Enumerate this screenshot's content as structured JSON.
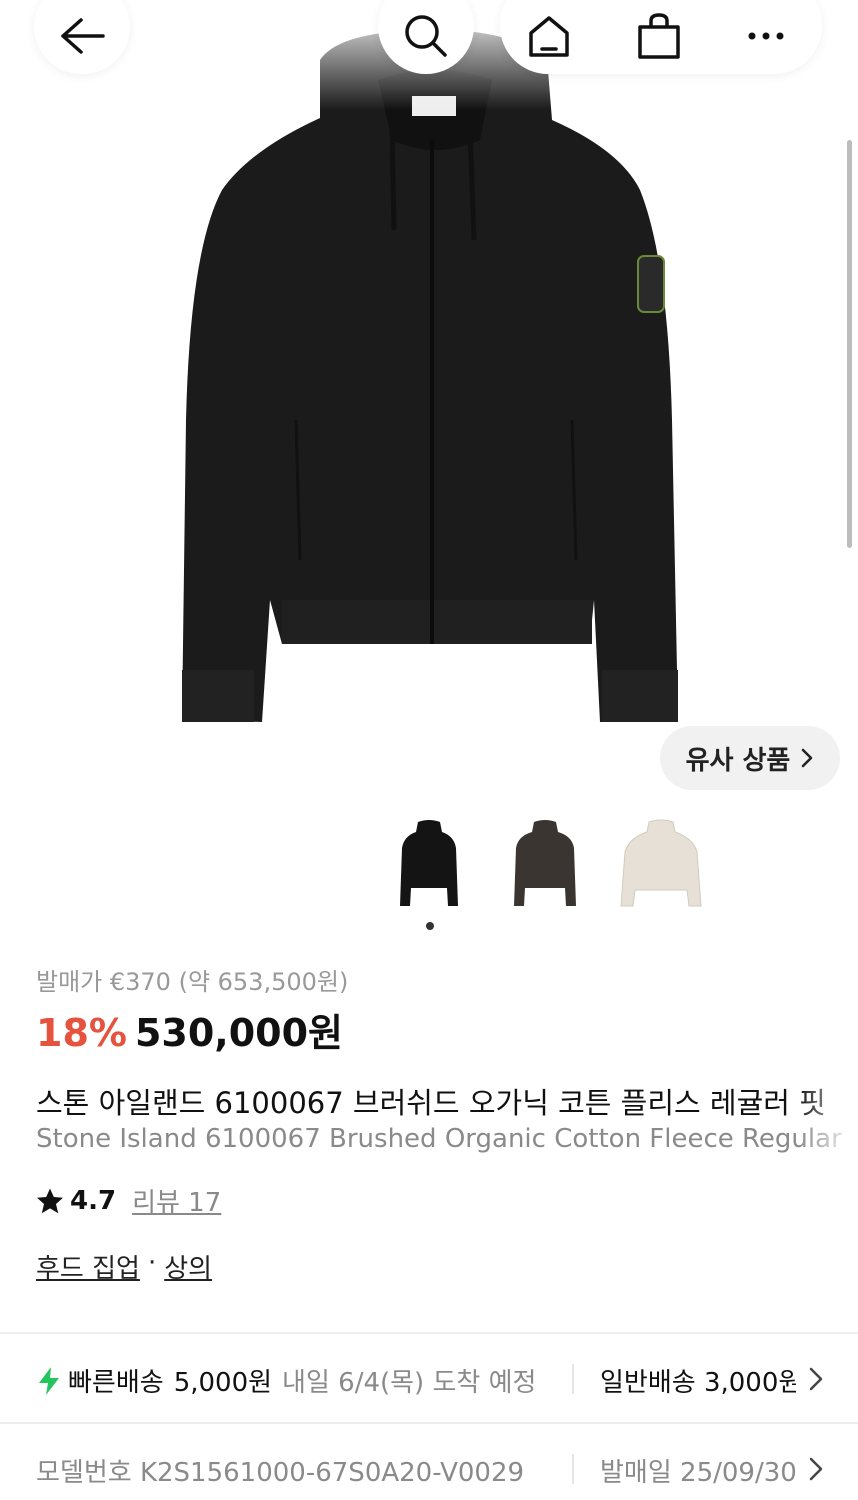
{
  "nav": {
    "back_icon": "arrow-left-icon",
    "search_icon": "search-icon",
    "home_icon": "home-icon",
    "cart_icon": "shopping-bag-icon",
    "more_icon": "more-horizontal-icon"
  },
  "similar": {
    "label": "유사 상품"
  },
  "thumbnails": [
    {
      "color": "#141414"
    },
    {
      "color": "#3a3531"
    },
    {
      "color": "#e6e0d6"
    }
  ],
  "price": {
    "release_label": "발매가 €370 (약 653,500원)",
    "discount": "18%",
    "current": "530,000원",
    "discount_color": "#e5533f"
  },
  "product": {
    "title_ko": "스톤 아일랜드 6100067 브러쉬드 오가닉 코튼 플리스 레귤러 핏",
    "title_en": "Stone Island 6100067 Brushed Organic Cotton Fleece Regular"
  },
  "rating": {
    "score": "4.7",
    "review_label": "리뷰 17"
  },
  "category": {
    "primary": "후드 집업",
    "separator": "·",
    "secondary": "상의"
  },
  "shipping": {
    "fast_label": "빠른배송",
    "fast_price": "5,000원",
    "fast_eta": "내일 6/4(목) 도착 예정",
    "normal": "일반배송 3,000원",
    "fast_icon_color": "#22c55e"
  },
  "details": {
    "model_label": "모델번호",
    "model_value": "K2S1561000-67S0A20-V0029",
    "release_date": "발매일 25/09/30"
  }
}
